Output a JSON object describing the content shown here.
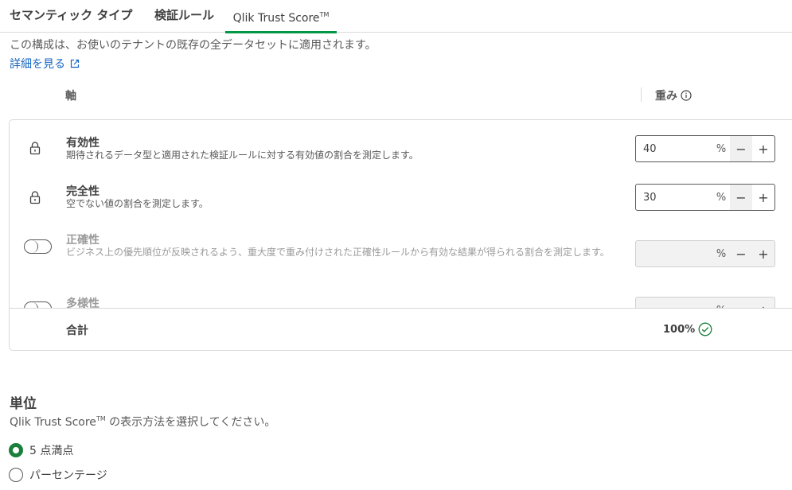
{
  "tabs": [
    {
      "label": "セマンティック タイプ"
    },
    {
      "label": "検証ルール"
    },
    {
      "label": "Qlik Trust Score",
      "tm": "TM"
    }
  ],
  "description": "この構成は、お使いのテナントの既存の全データセットに適用されます。",
  "learn_more": "詳細を見る",
  "columns": {
    "axis": "軸",
    "weight": "重み"
  },
  "rows": [
    {
      "title": "有効性",
      "desc": "期待されるデータ型と適用された検証ルールに対する有効値の割合を測定します。",
      "weight": "40",
      "pct": "%",
      "state": "locked"
    },
    {
      "title": "完全性",
      "desc": "空でない値の割合を測定します。",
      "weight": "30",
      "pct": "%",
      "state": "locked"
    },
    {
      "title": "正確性",
      "desc": "ビジネス上の優先順位が反映されるよう、重大度で重み付けされた正確性ルールから有効な結果が得られる割合を測定します。",
      "weight": "",
      "pct": "%",
      "state": "off"
    },
    {
      "title": "多様性",
      "desc": "",
      "weight": "",
      "pct": "%",
      "state": "off"
    }
  ],
  "total": {
    "label": "合計",
    "value": "100%"
  },
  "unit": {
    "title": "単位",
    "desc_prefix": "Qlik Trust Score",
    "desc_tm": "TM",
    "desc_suffix": " の表示方法を選択してください。",
    "options": [
      {
        "label": "5 点満点",
        "selected": true
      },
      {
        "label": "パーセンテージ",
        "selected": false
      }
    ]
  },
  "colors": {
    "accent": "#009845",
    "link": "#1565c0",
    "radio": "#1b7f3b"
  }
}
